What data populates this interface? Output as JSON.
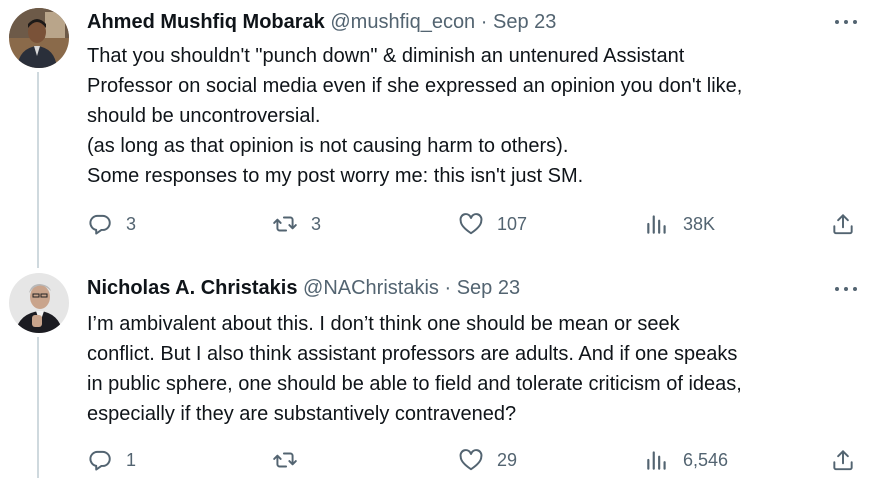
{
  "tweets": [
    {
      "name": "Ahmed Mushfiq Mobarak",
      "handle": "@mushfiq_econ",
      "separator": "·",
      "date": "Sep 23",
      "lines": [
        "That you shouldn't \"punch down\" & diminish an untenured Assistant",
        "Professor on social media even if she expressed an opinion you don't like,",
        "should be uncontroversial.",
        "(as long as that opinion is not causing harm to others).",
        "Some responses to my post worry me: this isn't just SM."
      ],
      "replies": "3",
      "retweets": "3",
      "likes": "107",
      "views": "38K"
    },
    {
      "name": "Nicholas A. Christakis",
      "handle": "@NAChristakis",
      "separator": "·",
      "date": "Sep 23",
      "lines": [
        "I’m ambivalent about this. I don’t think one should be mean or seek",
        "conflict. But I also think assistant professors are adults. And if one speaks",
        "in public sphere, one should be able to field and tolerate criticism of ideas,",
        "especially if they are substantively contravened?"
      ],
      "replies": "1",
      "retweets": "",
      "likes": "29",
      "views": "6,546"
    }
  ],
  "icons": {
    "reply": "reply-icon",
    "retweet": "retweet-icon",
    "like": "heart-icon",
    "views": "views-icon",
    "share": "share-icon",
    "more": "more-icon"
  },
  "colors": {
    "text": "#0f1419",
    "secondary": "#536471",
    "thread_line": "#cfd9de"
  }
}
